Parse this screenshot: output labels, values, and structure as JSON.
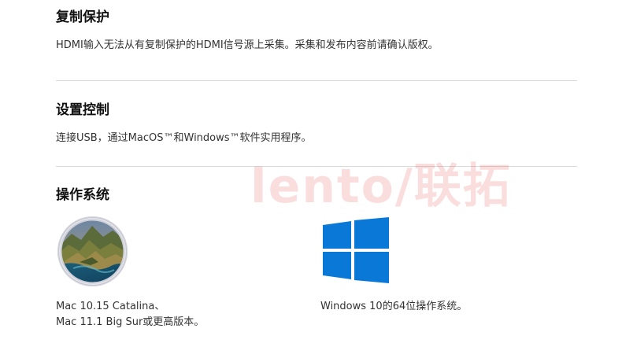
{
  "copy_protection": {
    "title": "复制保护",
    "body": "HDMI输入无法从有复制保护的HDMI信号源上采集。采集和发布内容前请确认版权。"
  },
  "setup_control": {
    "title": "设置控制",
    "body": "连接USB，通过MacOS™和Windows™软件实用程序。"
  },
  "operating_system": {
    "title": "操作系统",
    "mac": {
      "line1": "Mac 10.15 Catalina、",
      "line2": "Mac 11.1 Big Sur或更高版本。",
      "icon": "macos-catalina-icon"
    },
    "windows": {
      "caption": "Windows 10的64位操作系统。",
      "icon": "windows-logo-icon",
      "color": "#0a78d7"
    }
  },
  "watermark": "lento/联拓",
  "colors": {
    "divider": "#d9d9d9",
    "watermark": "#e65a5a",
    "windows_blue": "#0a78d7"
  }
}
